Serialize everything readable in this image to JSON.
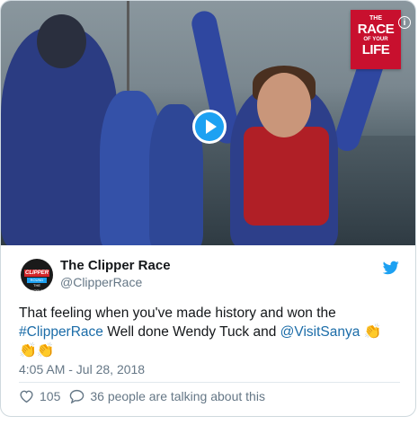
{
  "media": {
    "badge": {
      "line1": "THE",
      "line2": "RACE",
      "line3": "OF YOUR",
      "line4": "LIFE"
    },
    "info_glyph": "i",
    "play_icon": "play-icon"
  },
  "author": {
    "name": "The Clipper Race",
    "handle": "@ClipperRace",
    "avatar_text": "CLIPPER",
    "avatar_subtext": "ROUND THE WORLD"
  },
  "tweet": {
    "text_before": "That feeling when you've made history and won the ",
    "hashtag": "#ClipperRace",
    "text_middle": " Well done Wendy Tuck and ",
    "mention": "@VisitSanya",
    "emoji1": "👏",
    "emoji2": "👏👏",
    "timestamp": "4:05 AM - Jul 28, 2018"
  },
  "engagement": {
    "likes": "105",
    "talking": "36 people are talking about this"
  },
  "colors": {
    "accent": "#1da1f2",
    "link": "#1b6ca8",
    "brand_red": "#c8102e"
  }
}
